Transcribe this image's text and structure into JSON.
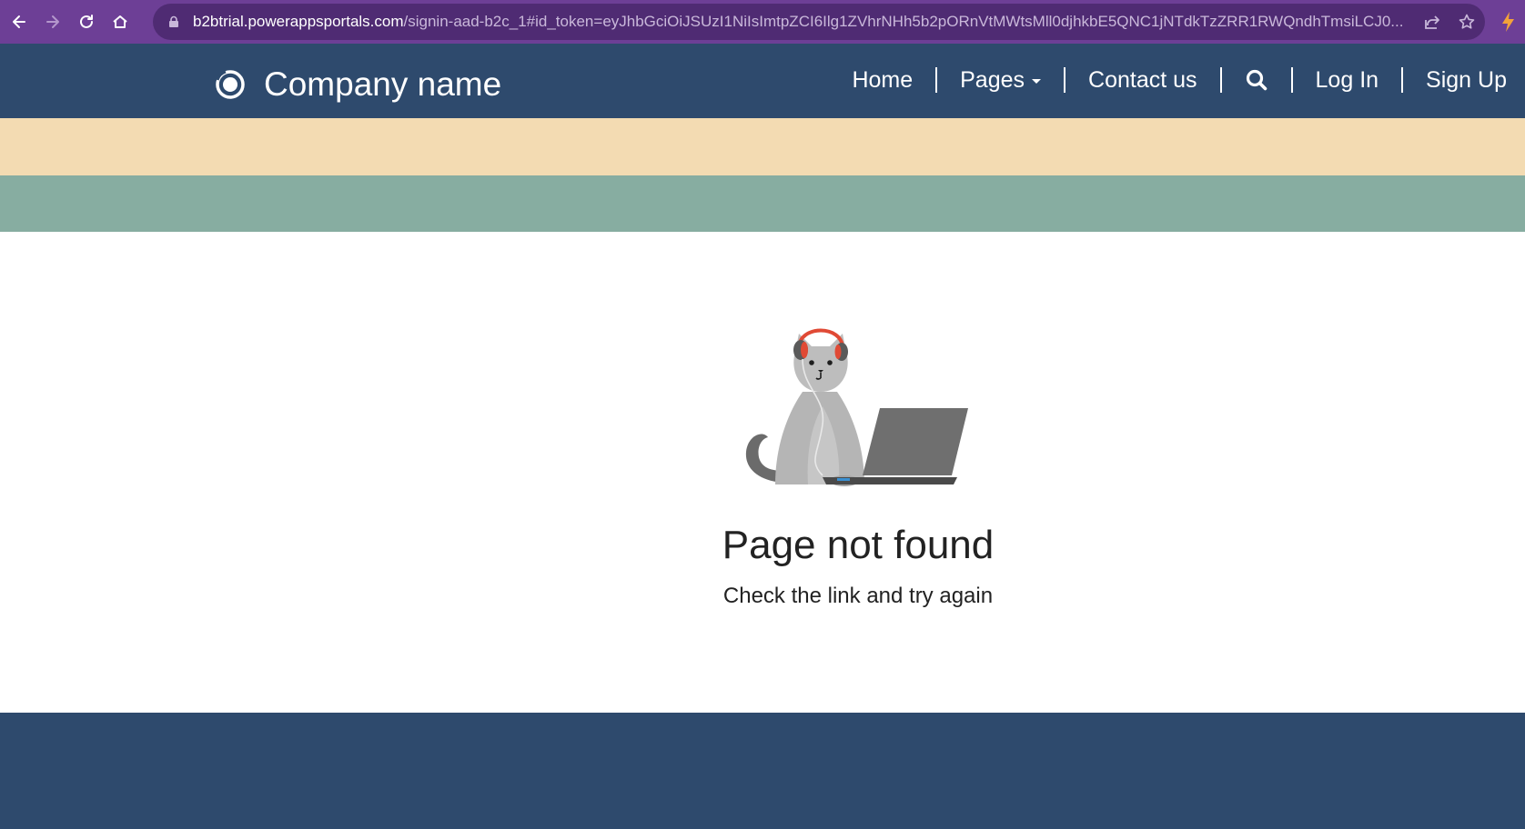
{
  "browser": {
    "url_host": "b2btrial.powerappsportals.com",
    "url_path": "/signin-aad-b2c_1#id_token=eyJhbGciOiJSUzI1NiIsImtpZCI6Ilg1ZVhrNHh5b2pORnVtMWtsMll0djhkbE5QNC1jNTdkTzZRR1RWQndhTmsiLCJ0...",
    "back_icon": "arrow-left-icon",
    "forward_icon": "arrow-right-icon",
    "reload_icon": "reload-icon",
    "home_icon": "home-icon",
    "share_icon": "share-icon",
    "bookmark_icon": "star-icon",
    "extension_icon": "lightning-icon"
  },
  "header": {
    "brand_name": "Company name",
    "logo_icon": "circle-logo-icon",
    "nav": {
      "home": "Home",
      "pages": "Pages",
      "contact": "Contact us",
      "search_icon": "search-icon",
      "login": "Log In",
      "signup": "Sign Up"
    }
  },
  "main": {
    "illustration": "cat-with-headphones-and-laptop",
    "title": "Page not found",
    "subtitle": "Check the link and try again"
  },
  "colors": {
    "browser_bar": "#6d3f96",
    "header": "#2e4a6d",
    "band_sand": "#f3dbb2",
    "band_sage": "#87ada1",
    "footer": "#2e4a6d"
  }
}
